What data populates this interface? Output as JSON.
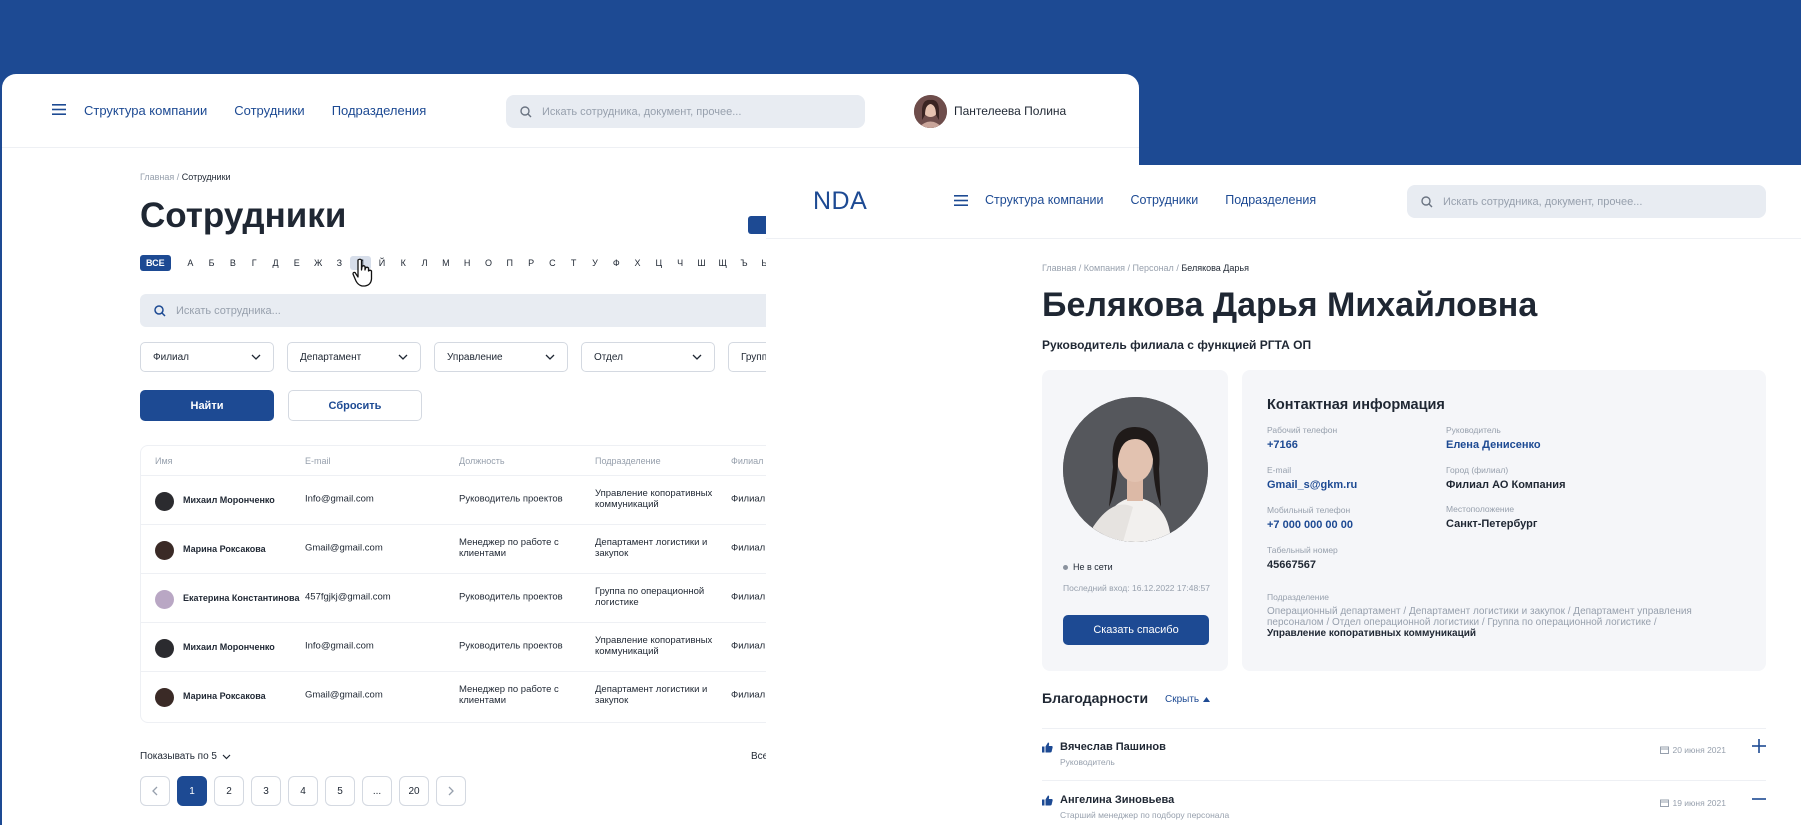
{
  "back": {
    "nav": [
      "Структура компании",
      "Сотрудники",
      "Подразделения"
    ],
    "search_placeholder": "Искать сотрудника, документ, прочее...",
    "user_name": "Пантелеева Полина",
    "breadcrumb": {
      "home": "Главная",
      "current": "Сотрудники"
    },
    "title": "Сотрудники",
    "alphabet_all": "ВСЕ",
    "alphabet": [
      "А",
      "Б",
      "В",
      "Г",
      "Д",
      "Е",
      "Ж",
      "З",
      "И",
      "Й",
      "К",
      "Л",
      "М",
      "Н",
      "О",
      "П",
      "Р",
      "С",
      "Т",
      "У",
      "Ф",
      "Х",
      "Ц",
      "Ч",
      "Ш",
      "Щ",
      "Ъ",
      "Ы"
    ],
    "alphabet_selected": "И",
    "employee_search_placeholder": "Искать сотрудника...",
    "filters": [
      "Филиал",
      "Департамент",
      "Управление",
      "Отдел",
      "Групп"
    ],
    "find_label": "Найти",
    "reset_label": "Сбросить",
    "columns": [
      "Имя",
      "E-mail",
      "Должность",
      "Подразделение",
      "Филиал"
    ],
    "rows": [
      {
        "name": "Михаил Моронченко",
        "email": "Info@gmail.com",
        "position": "Руководитель проектов",
        "dept": "Управление копоративных коммуникаций",
        "branch": "Филиал"
      },
      {
        "name": "Марина Роксакова",
        "email": "Gmail@gmail.com",
        "position": "Менеджер по работе с клиентами",
        "dept": "Департамент логистики и закупок",
        "branch": "Филиал"
      },
      {
        "name": "Екатерина Константинова",
        "email": "457fgjkj@gmail.com",
        "position": "Руководитель проектов",
        "dept": "Группа по операционной логистике",
        "branch": "Филиал"
      },
      {
        "name": "Михаил Моронченко",
        "email": "Info@gmail.com",
        "position": "Руководитель проектов",
        "dept": "Управление копоративных коммуникаций",
        "branch": "Филиал"
      },
      {
        "name": "Марина Роксакова",
        "email": "Gmail@gmail.com",
        "position": "Менеджер по работе с клиентами",
        "dept": "Департамент логистики и закупок",
        "branch": "Филиал"
      }
    ],
    "show_label": "Показывать по 5",
    "all_label": "Все",
    "pages": [
      "1",
      "2",
      "3",
      "4",
      "5",
      "...",
      "20"
    ],
    "active_page": "1"
  },
  "front": {
    "logo": "NDA",
    "nav": [
      "Структура компании",
      "Сотрудники",
      "Подразделения"
    ],
    "search_placeholder": "Искать сотрудника, документ, прочее...",
    "breadcrumb": [
      "Главная",
      "Компания",
      "Персонал",
      "Белякова Дарья"
    ],
    "name": "Белякова Дарья Михайловна",
    "role": "Руководитель филиала с функцией РГТА ОП",
    "status": "Не в сети",
    "last_login": "Последний вход: 16.12.2022 17:48:57",
    "thanks_button": "Сказать спасибо",
    "contact_title": "Контактная информация",
    "fields": {
      "work_phone_label": "Рабочий телефон",
      "work_phone": "+7166",
      "manager_label": "Руководитель",
      "manager": "Елена Денисенко",
      "email_label": "E-mail",
      "email": "Gmail_s@gkm.ru",
      "city_label": "Город (филиал)",
      "city": "Филиал АО Компания",
      "mobile_label": "Мобильный телефон",
      "mobile": "+7 000 000 00 00",
      "location_label": "Местоположение",
      "location": "Санкт-Петербург",
      "tab_label": "Табельный номер",
      "tab": "45667567"
    },
    "dept_label": "Подразделение",
    "dept_path": "Операционный департамент / Департамент логистики и закупок / Департамент управления персоналом  / Отдел операционной логистики / Группа по операционной логистике /",
    "dept_last": "Управление копоративных коммуникаций",
    "thanks_title": "Благодарности",
    "hide_label": "Скрыть",
    "thanks": [
      {
        "name": "Вячеслав Пашинов",
        "role": "Руководитель",
        "date": "20 июня 2021"
      },
      {
        "name": "Ангелина Зиновьева",
        "role": "Старший менеджер по подбору персонала",
        "date": "19 июня 2021"
      }
    ]
  }
}
